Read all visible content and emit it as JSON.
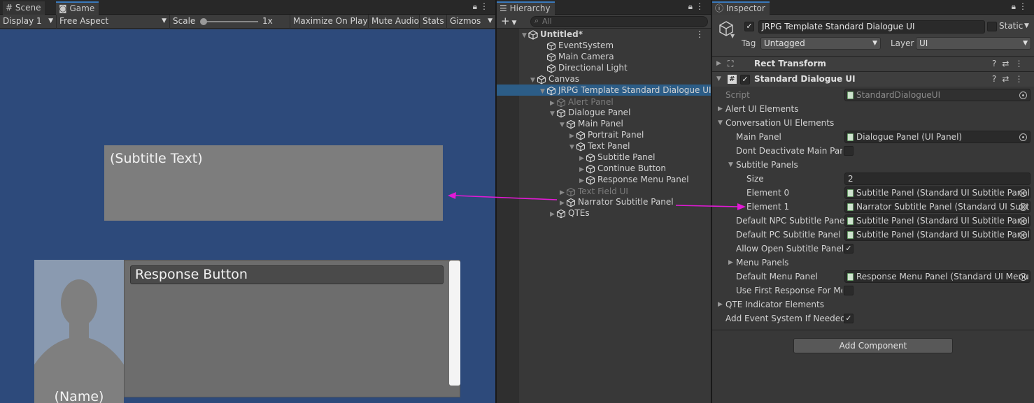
{
  "scene_game_panel": {
    "tabs": [
      {
        "label": "Scene"
      },
      {
        "label": "Game"
      }
    ],
    "toolbar": {
      "display": "Display 1",
      "aspect": "Free Aspect",
      "scale_label": "Scale",
      "scale_value": "1x",
      "maximize": "Maximize On Play",
      "mute": "Mute Audio",
      "stats": "Stats",
      "gizmos": "Gizmos"
    },
    "game": {
      "subtitle_text": "(Subtitle Text)",
      "response_button": "Response Button",
      "name": "(Name)"
    }
  },
  "hierarchy": {
    "title": "Hierarchy",
    "search_placeholder": "All",
    "items": [
      {
        "label": "Untitled*"
      },
      {
        "label": "EventSystem"
      },
      {
        "label": "Main Camera"
      },
      {
        "label": "Directional Light"
      },
      {
        "label": "Canvas"
      },
      {
        "label": "JRPG Template Standard Dialogue UI"
      },
      {
        "label": "Alert Panel"
      },
      {
        "label": "Dialogue Panel"
      },
      {
        "label": "Main Panel"
      },
      {
        "label": "Portrait Panel"
      },
      {
        "label": "Text Panel"
      },
      {
        "label": "Subtitle Panel"
      },
      {
        "label": "Continue Button"
      },
      {
        "label": "Response Menu Panel"
      },
      {
        "label": "Text Field UI"
      },
      {
        "label": "Narrator Subtitle Panel"
      },
      {
        "label": "QTEs"
      }
    ]
  },
  "inspector": {
    "title": "Inspector",
    "object_name": "JRPG Template Standard Dialogue UI",
    "static_label": "Static",
    "tag_label": "Tag",
    "tag_value": "Untagged",
    "layer_label": "Layer",
    "layer_value": "UI",
    "rect_transform": "Rect Transform",
    "component_name": "Standard Dialogue UI",
    "script_label": "Script",
    "script_value": "StandardDialogueUI",
    "alert_ui": "Alert UI Elements",
    "conversation_ui": "Conversation UI Elements",
    "main_panel_label": "Main Panel",
    "main_panel_value": "Dialogue Panel (UI Panel)",
    "dont_deactivate": "Dont Deactivate Main Pane",
    "subtitle_panels": "Subtitle Panels",
    "size_label": "Size",
    "size_value": "2",
    "element0_label": "Element 0",
    "element0_value": "Subtitle Panel (Standard UI Subtitle Panel)",
    "element1_label": "Element 1",
    "element1_value": "Narrator Subtitle Panel (Standard UI Subti",
    "default_npc_label": "Default NPC Subtitle Panel",
    "default_npc_value": "Subtitle Panel (Standard UI Subtitle Panel)",
    "default_pc_label": "Default PC Subtitle Panel",
    "default_pc_value": "Subtitle Panel (Standard UI Subtitle Panel)",
    "allow_open": "Allow Open Subtitle Panels",
    "menu_panels": "Menu Panels",
    "default_menu_label": "Default Menu Panel",
    "default_menu_value": "Response Menu Panel (Standard UI Menu",
    "use_first": "Use First Response For Men",
    "qte_indicator": "QTE Indicator Elements",
    "add_event_system": "Add Event System If Needed",
    "add_component": "Add Component"
  },
  "colors": {
    "accent": "#3a79bb",
    "selection": "#2c5d87",
    "game_bg": "#2d4a7b",
    "annotation_arrow": "#e21ad6"
  }
}
